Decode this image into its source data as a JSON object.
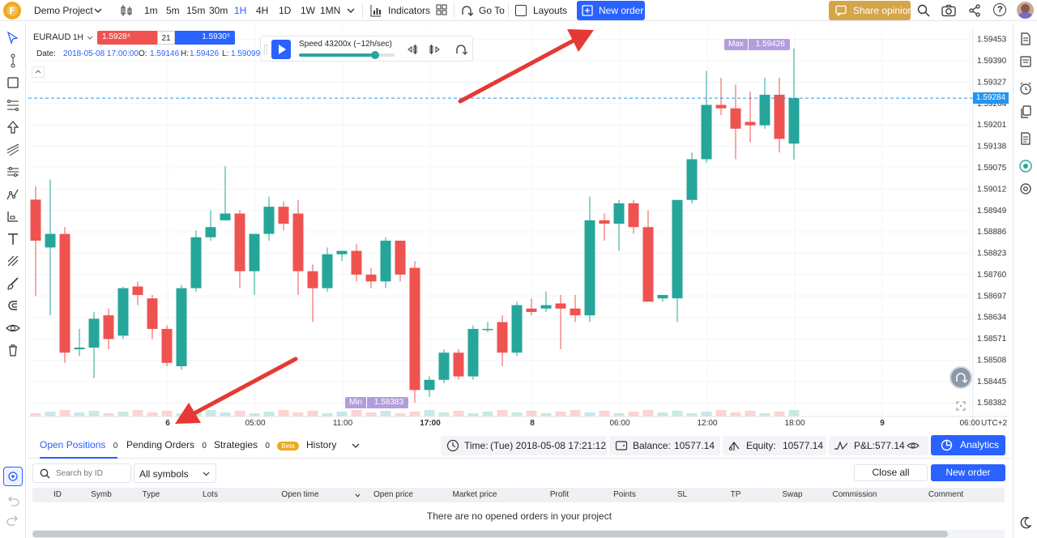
{
  "topbar": {
    "project": "Demo Project",
    "timeframes": [
      "1m",
      "5m",
      "15m",
      "30m",
      "1H",
      "4H",
      "1D",
      "1W",
      "1MN"
    ],
    "active_timeframe": "1H",
    "indicators": "Indicators",
    "goto": "Go To",
    "layouts": "Layouts",
    "new_order": "New order",
    "share": "Share opinion"
  },
  "symbol_box": {
    "symbol": "EURAUD",
    "interval": "1H",
    "sell_price": "1.5928⁴",
    "spread": "21",
    "buy_price": "1.5930⁵",
    "date_label": "Date:",
    "date_value": "2018-05-08 17:00:00",
    "o_label": "O:",
    "o_value": "1.59146",
    "h_label": "H:",
    "h_value": "1.59426",
    "l_label": "L:",
    "l_value": "1.59099"
  },
  "speed": {
    "label": "Speed 43200x (~12h/sec)",
    "slider_fraction": 0.8
  },
  "markers": {
    "max_label": "Max",
    "max_value": "1.59426",
    "min_label": "Min",
    "min_value": "1.58383",
    "current_price": "1.59284"
  },
  "chart_data": {
    "type": "candlestick",
    "symbol": "EURAUD",
    "y_ticks": [
      "1.59453",
      "1.59390",
      "1.59327",
      "1.59264",
      "1.59201",
      "1.59138",
      "1.59075",
      "1.59012",
      "1.58949",
      "1.58886",
      "1.58823",
      "1.58760",
      "1.58697",
      "1.58634",
      "1.58571",
      "1.58508",
      "1.58445",
      "1.58382"
    ],
    "x_ticks": [
      "6",
      "05:00",
      "11:00",
      "17:00",
      "8",
      "06:00",
      "12:00",
      "18:00",
      "9",
      "06:00"
    ],
    "x_tick_bold": [
      true,
      false,
      false,
      true,
      true,
      false,
      false,
      false,
      true,
      false
    ],
    "timezone": "UTC+2",
    "ylim": [
      1.58342,
      1.59488
    ],
    "candles": [
      {
        "o": 1.58981,
        "h": 1.5902,
        "l": 1.58697,
        "c": 1.5886
      },
      {
        "o": 1.5884,
        "h": 1.5904,
        "l": 1.5864,
        "c": 1.5888
      },
      {
        "o": 1.5888,
        "h": 1.589,
        "l": 1.585,
        "c": 1.5853
      },
      {
        "o": 1.5854,
        "h": 1.586,
        "l": 1.5852,
        "c": 1.58545
      },
      {
        "o": 1.58545,
        "h": 1.5865,
        "l": 1.58455,
        "c": 1.5863
      },
      {
        "o": 1.5864,
        "h": 1.5866,
        "l": 1.5854,
        "c": 1.5857
      },
      {
        "o": 1.5858,
        "h": 1.58725,
        "l": 1.5857,
        "c": 1.5872
      },
      {
        "o": 1.58725,
        "h": 1.5874,
        "l": 1.5867,
        "c": 1.587
      },
      {
        "o": 1.5869,
        "h": 1.587,
        "l": 1.5857,
        "c": 1.586
      },
      {
        "o": 1.586,
        "h": 1.5861,
        "l": 1.5849,
        "c": 1.585
      },
      {
        "o": 1.5849,
        "h": 1.5873,
        "l": 1.5848,
        "c": 1.5872
      },
      {
        "o": 1.5872,
        "h": 1.5889,
        "l": 1.5871,
        "c": 1.5887
      },
      {
        "o": 1.5887,
        "h": 1.5895,
        "l": 1.5886,
        "c": 1.589
      },
      {
        "o": 1.5892,
        "h": 1.5908,
        "l": 1.5892,
        "c": 1.5894
      },
      {
        "o": 1.5894,
        "h": 1.5895,
        "l": 1.5872,
        "c": 1.5877
      },
      {
        "o": 1.5877,
        "h": 1.5883,
        "l": 1.587,
        "c": 1.5888
      },
      {
        "o": 1.5888,
        "h": 1.5899,
        "l": 1.5886,
        "c": 1.5896
      },
      {
        "o": 1.5896,
        "h": 1.58975,
        "l": 1.5889,
        "c": 1.5891
      },
      {
        "o": 1.5894,
        "h": 1.5898,
        "l": 1.587,
        "c": 1.5877
      },
      {
        "o": 1.5877,
        "h": 1.5879,
        "l": 1.5862,
        "c": 1.5872
      },
      {
        "o": 1.5872,
        "h": 1.5884,
        "l": 1.5871,
        "c": 1.5882
      },
      {
        "o": 1.5882,
        "h": 1.5883,
        "l": 1.588,
        "c": 1.5883
      },
      {
        "o": 1.5883,
        "h": 1.5885,
        "l": 1.5874,
        "c": 1.5876
      },
      {
        "o": 1.5876,
        "h": 1.5878,
        "l": 1.5872,
        "c": 1.5874
      },
      {
        "o": 1.5874,
        "h": 1.5887,
        "l": 1.5872,
        "c": 1.5886
      },
      {
        "o": 1.5886,
        "h": 1.5886,
        "l": 1.5874,
        "c": 1.5876
      },
      {
        "o": 1.5878,
        "h": 1.588,
        "l": 1.58383,
        "c": 1.5842
      },
      {
        "o": 1.5842,
        "h": 1.5846,
        "l": 1.584,
        "c": 1.5845
      },
      {
        "o": 1.5845,
        "h": 1.5854,
        "l": 1.5844,
        "c": 1.5853
      },
      {
        "o": 1.5853,
        "h": 1.5854,
        "l": 1.5845,
        "c": 1.5846
      },
      {
        "o": 1.5846,
        "h": 1.5861,
        "l": 1.5845,
        "c": 1.586
      },
      {
        "o": 1.586,
        "h": 1.5862,
        "l": 1.5859,
        "c": 1.586
      },
      {
        "o": 1.5862,
        "h": 1.5864,
        "l": 1.5849,
        "c": 1.5853
      },
      {
        "o": 1.5853,
        "h": 1.5868,
        "l": 1.5852,
        "c": 1.5867
      },
      {
        "o": 1.5866,
        "h": 1.5869,
        "l": 1.5864,
        "c": 1.5865
      },
      {
        "o": 1.5866,
        "h": 1.5871,
        "l": 1.5865,
        "c": 1.5867
      },
      {
        "o": 1.58675,
        "h": 1.587,
        "l": 1.5854,
        "c": 1.5866
      },
      {
        "o": 1.5866,
        "h": 1.587,
        "l": 1.5862,
        "c": 1.5864
      },
      {
        "o": 1.5864,
        "h": 1.5899,
        "l": 1.5862,
        "c": 1.5892
      },
      {
        "o": 1.5892,
        "h": 1.5894,
        "l": 1.5886,
        "c": 1.5891
      },
      {
        "o": 1.5891,
        "h": 1.5898,
        "l": 1.5883,
        "c": 1.5897
      },
      {
        "o": 1.5897,
        "h": 1.5898,
        "l": 1.5888,
        "c": 1.589
      },
      {
        "o": 1.589,
        "h": 1.5895,
        "l": 1.5868,
        "c": 1.5868
      },
      {
        "o": 1.5869,
        "h": 1.587,
        "l": 1.5868,
        "c": 1.587
      },
      {
        "o": 1.5869,
        "h": 1.5898,
        "l": 1.5862,
        "c": 1.5898
      },
      {
        "o": 1.5898,
        "h": 1.5912,
        "l": 1.5897,
        "c": 1.591
      },
      {
        "o": 1.591,
        "h": 1.5936,
        "l": 1.5909,
        "c": 1.5926
      },
      {
        "o": 1.5926,
        "h": 1.5934,
        "l": 1.5923,
        "c": 1.5925
      },
      {
        "o": 1.5925,
        "h": 1.5932,
        "l": 1.591,
        "c": 1.5919
      },
      {
        "o": 1.5921,
        "h": 1.593,
        "l": 1.5915,
        "c": 1.592
      },
      {
        "o": 1.592,
        "h": 1.5934,
        "l": 1.5919,
        "c": 1.5929
      },
      {
        "o": 1.5929,
        "h": 1.5934,
        "l": 1.5912,
        "c": 1.5916
      },
      {
        "o": 1.59146,
        "h": 1.59426,
        "l": 1.59099,
        "c": 1.5928
      }
    ]
  },
  "bottom": {
    "tabs": [
      {
        "label": "Open Positions",
        "count": "0"
      },
      {
        "label": "Pending Orders",
        "count": "0"
      },
      {
        "label": "Strategies",
        "count": "0",
        "badge": "Beta"
      },
      {
        "label": "History"
      }
    ],
    "time_label": "Time:",
    "time_value": "(Tue) 2018-05-08 17:21:12",
    "balance_label": "Balance:",
    "balance_value": "10577.14",
    "equity_label": "Equity:",
    "equity_value": "10577.14",
    "pnl_label": "P&L:",
    "pnl_value": "577.14",
    "analytics": "Analytics",
    "search_placeholder": "Search by ID",
    "symbols_select": "All symbols",
    "close_all": "Close all",
    "new_order": "New order",
    "columns": [
      "ID",
      "Symb",
      "Type",
      "Lots",
      "Open time",
      "Open price",
      "Market price",
      "Profit",
      "Points",
      "SL",
      "TP",
      "Swap",
      "Commission",
      "Comment"
    ],
    "empty_message": "There are no opened orders in your project"
  },
  "colors": {
    "up": "#26a69a",
    "down": "#ef5350",
    "accent": "#2962ff",
    "annotation_arrow": "#e53935",
    "share_button": "#d5a54a",
    "marker_purple": "#b39ddb"
  }
}
